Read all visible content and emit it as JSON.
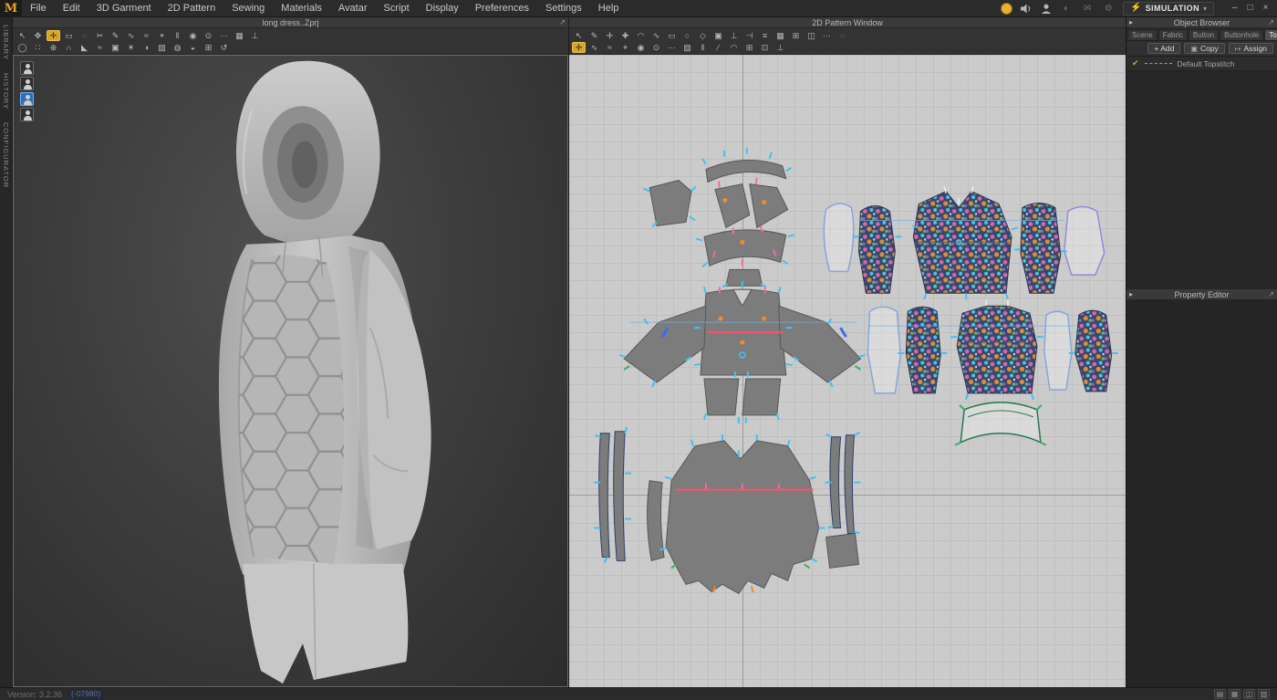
{
  "app": {
    "logo_text": "M",
    "menus": [
      "File",
      "Edit",
      "3D Garment",
      "2D Pattern",
      "Sewing",
      "Materials",
      "Avatar",
      "Script",
      "Display",
      "Preferences",
      "Settings",
      "Help"
    ],
    "topbar_icon_names": [
      "cloud-sync-icon",
      "volume-icon",
      "account-icon",
      "theme-icon",
      "mail-icon",
      "settings-gear-icon"
    ],
    "dim_icons": [
      {
        "name": "theme-icon",
        "glyph": "◐"
      },
      {
        "name": "mail-icon",
        "glyph": "✉"
      },
      {
        "name": "settings-gear-icon",
        "glyph": "⚙"
      }
    ],
    "simulation": {
      "glyph": "⚡",
      "label": "SIMULATION",
      "caret": "▾"
    },
    "window_controls": [
      {
        "name": "minimize-button",
        "glyph": "–"
      },
      {
        "name": "maximize-button",
        "glyph": "□"
      },
      {
        "name": "close-button",
        "glyph": "×"
      }
    ]
  },
  "left_rail": {
    "items": [
      {
        "label": "LIBRARY"
      },
      {
        "label": "HISTORY"
      },
      {
        "label": "CONFIGURATOR"
      }
    ]
  },
  "panel3d": {
    "title": "long dress..Zprj",
    "expand_glyph": "↗",
    "toolbar_row1": [
      {
        "name": "select-tool",
        "glyph": "↖"
      },
      {
        "name": "move-tool",
        "glyph": "✥"
      },
      {
        "name": "pin-tool",
        "glyph": "✛",
        "active": true
      },
      {
        "name": "box-select-tool",
        "glyph": "▭"
      },
      {
        "name": "lasso-select-tool",
        "glyph": "◌"
      },
      {
        "name": "scissors-tool",
        "glyph": "✂"
      },
      {
        "name": "pen-tool",
        "glyph": "✎"
      },
      {
        "name": "segment-sewing-tool",
        "glyph": "∿"
      },
      {
        "name": "free-sewing-tool",
        "glyph": "≈"
      },
      {
        "name": "pin-box-tool",
        "glyph": "⌖"
      },
      {
        "name": "zipper-tool",
        "glyph": "‖"
      },
      {
        "name": "button-tool",
        "glyph": "◉"
      },
      {
        "name": "buttonhole-tool",
        "glyph": "⊙"
      },
      {
        "name": "topstitch-tool",
        "glyph": "⋯"
      },
      {
        "name": "fabric-texture-tool",
        "glyph": "▦"
      },
      {
        "name": "measure-tool",
        "glyph": "⊥"
      }
    ],
    "toolbar_row2": [
      {
        "name": "avatar-display-tool",
        "glyph": "◯"
      },
      {
        "name": "arrangement-point-tool",
        "glyph": "∷"
      },
      {
        "name": "gizmo-tool",
        "glyph": "⊕"
      },
      {
        "name": "hanger-tool",
        "glyph": "∩"
      },
      {
        "name": "fold-tool",
        "glyph": "◣"
      },
      {
        "name": "wind-tool",
        "glyph": "≈"
      },
      {
        "name": "camera-tool",
        "glyph": "▣"
      },
      {
        "name": "light-tool",
        "glyph": "☀"
      },
      {
        "name": "shadow-toggle",
        "glyph": "◑"
      },
      {
        "name": "surface-texture-toggle",
        "glyph": "▨"
      },
      {
        "name": "strain-map-toggle",
        "glyph": "◍"
      },
      {
        "name": "stress-map-toggle",
        "glyph": "◒"
      },
      {
        "name": "grid-toggle",
        "glyph": "⊞"
      },
      {
        "name": "reset-view-tool",
        "glyph": "↺"
      }
    ],
    "avatars": [
      {
        "name": "avatar-toggle-default"
      },
      {
        "name": "avatar-toggle-pose"
      },
      {
        "name": "avatar-toggle-selected",
        "active": true
      },
      {
        "name": "avatar-toggle-alt"
      }
    ]
  },
  "panel2d": {
    "title": "2D Pattern Window",
    "toolbar_row1": [
      {
        "name": "transform-pattern-tool",
        "glyph": "↖"
      },
      {
        "name": "edit-pattern-tool",
        "glyph": "✎"
      },
      {
        "name": "edit-point-tool",
        "glyph": "✛"
      },
      {
        "name": "add-point-tool",
        "glyph": "✚"
      },
      {
        "name": "edit-curve-tool",
        "glyph": "◠"
      },
      {
        "name": "curve-tool",
        "glyph": "∿"
      },
      {
        "name": "rectangle-tool",
        "glyph": "▭"
      },
      {
        "name": "circle-tool",
        "glyph": "○"
      },
      {
        "name": "dart-tool",
        "glyph": "◇"
      },
      {
        "name": "internal-shape-tool",
        "glyph": "▣"
      },
      {
        "name": "perpendicular-tool",
        "glyph": "⊥"
      },
      {
        "name": "notch-tool",
        "glyph": "⊣"
      },
      {
        "name": "grading-tool",
        "glyph": "≡"
      },
      {
        "name": "fabric-view-tool",
        "glyph": "▦"
      },
      {
        "name": "grid-snap-tool",
        "glyph": "⊞"
      },
      {
        "name": "mirror-tool",
        "glyph": "◫"
      },
      {
        "name": "baseline-tool",
        "glyph": "⋯"
      },
      {
        "name": "trace-tool",
        "glyph": "◌"
      }
    ],
    "toolbar_row2": [
      {
        "name": "topstitch-edit-tool",
        "glyph": "✛",
        "active": true
      },
      {
        "name": "segment-topstitch-tool",
        "glyph": "∿"
      },
      {
        "name": "free-topstitch-tool",
        "glyph": "≈"
      },
      {
        "name": "pin-tool-2d",
        "glyph": "⌖"
      },
      {
        "name": "button-tool-2d",
        "glyph": "◉"
      },
      {
        "name": "buttonhole-tool-2d",
        "glyph": "⊙"
      },
      {
        "name": "stitch-line-tool",
        "glyph": "⋯"
      },
      {
        "name": "shirring-tool",
        "glyph": "▨"
      },
      {
        "name": "zipper-tool-2d",
        "glyph": "‖"
      },
      {
        "name": "fold-line-tool",
        "glyph": "∕"
      },
      {
        "name": "flip-tool",
        "glyph": "◠"
      },
      {
        "name": "snap-toggle",
        "glyph": "⊞"
      },
      {
        "name": "texture-editor-tool",
        "glyph": "⊡"
      },
      {
        "name": "measure-tool-2d",
        "glyph": "⊥"
      }
    ]
  },
  "object_browser": {
    "title": "Object Browser",
    "collapse_glyph": "▸",
    "expand_glyph": "↗",
    "tabs": [
      {
        "label": "Scene"
      },
      {
        "label": "Fabric"
      },
      {
        "label": "Button"
      },
      {
        "label": "Buttonhole"
      },
      {
        "label": "Topstitch",
        "active": true
      }
    ],
    "add_label": "+ Add",
    "copy_label": "Copy",
    "copy_glyph": "▣",
    "assign_label": "Assign",
    "assign_glyph": "↦",
    "items": [
      {
        "check_glyph": "✔",
        "label": "Default Topstitch"
      }
    ]
  },
  "property_editor": {
    "title": "Property Editor",
    "collapse_glyph": "▸",
    "expand_glyph": "↗"
  },
  "status_bar": {
    "version": "Version: 3.2.36",
    "build": "(-07980)",
    "layout_icons": [
      {
        "name": "layout-3d-icon",
        "glyph": "▤"
      },
      {
        "name": "layout-2d-icon",
        "glyph": "▦"
      },
      {
        "name": "layout-split-icon",
        "glyph": "◫"
      },
      {
        "name": "layout-quad-icon",
        "glyph": "▥"
      }
    ]
  }
}
